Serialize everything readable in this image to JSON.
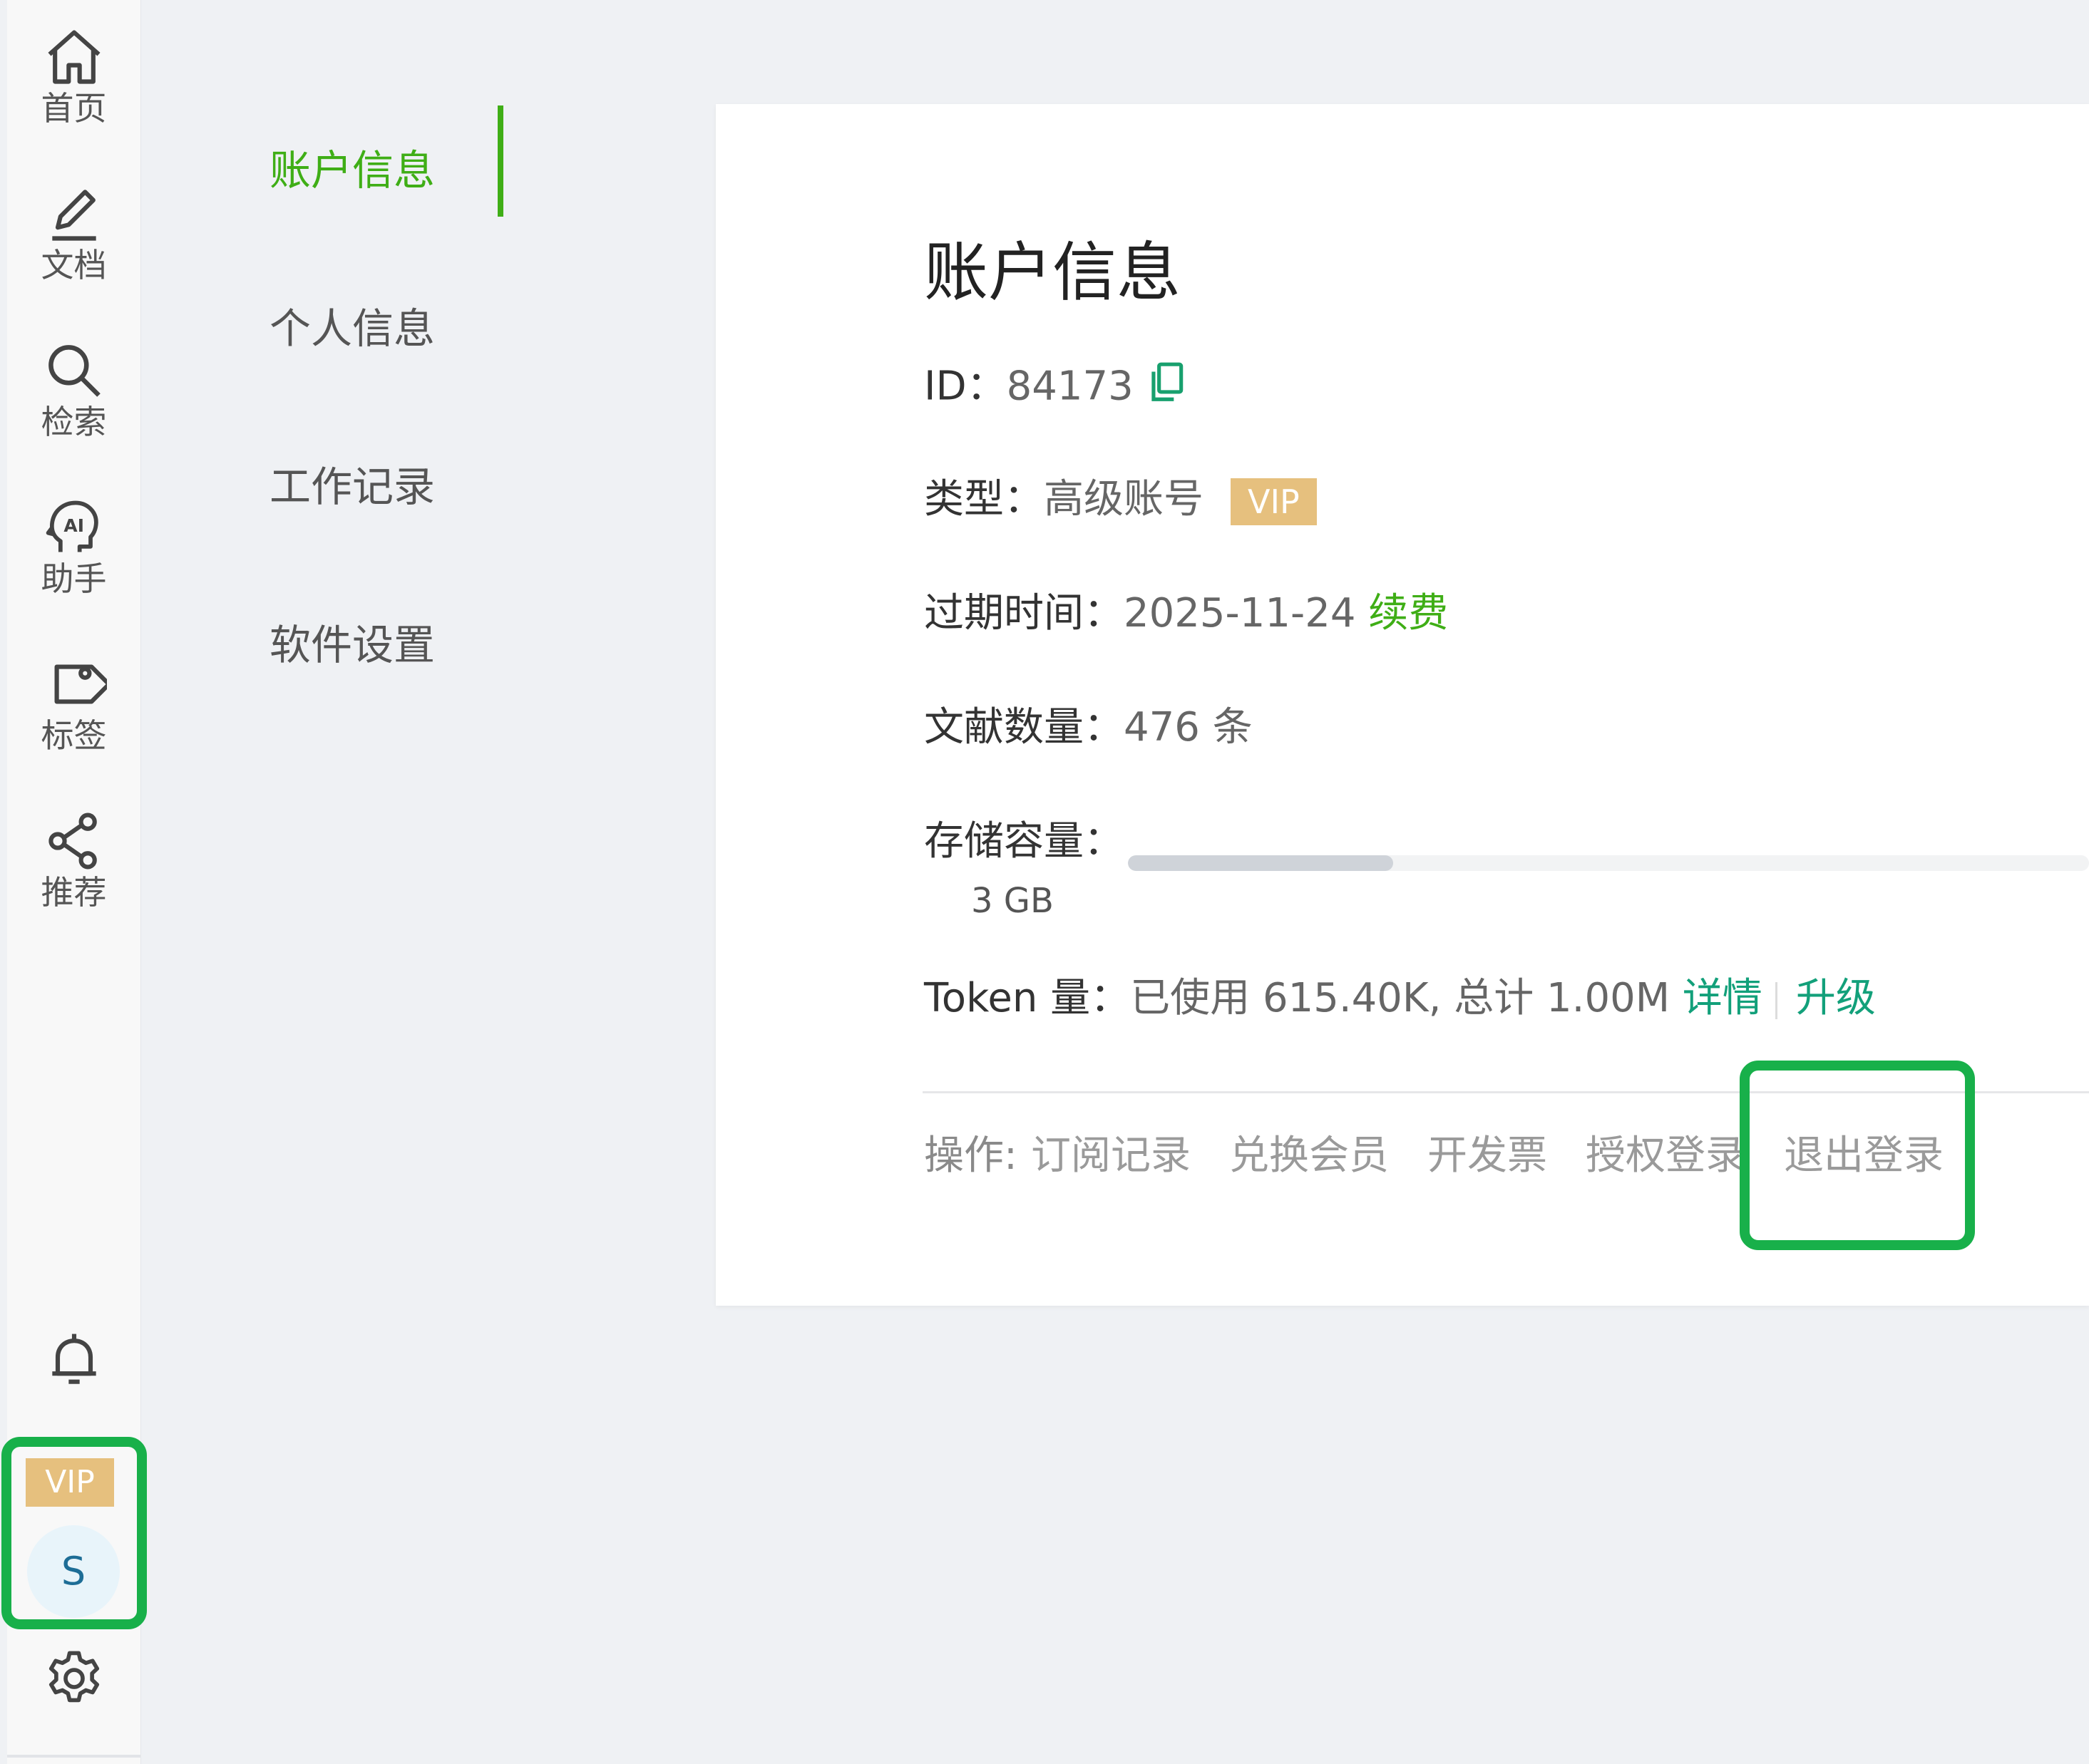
{
  "rail": {
    "items": [
      {
        "label": "首页",
        "icon": "home-icon"
      },
      {
        "label": "文档",
        "icon": "pen-icon"
      },
      {
        "label": "检索",
        "icon": "search-icon"
      },
      {
        "label": "助手",
        "icon": "ai-head-icon"
      },
      {
        "label": "标签",
        "icon": "tag-icon"
      },
      {
        "label": "推荐",
        "icon": "share-icon"
      }
    ],
    "bell_icon": "bell-icon",
    "vip_badge": "VIP",
    "avatar_initial": "S",
    "settings_icon": "gear-icon"
  },
  "submenu": {
    "items": [
      {
        "label": "账户信息",
        "active": true
      },
      {
        "label": "个人信息",
        "active": false
      },
      {
        "label": "工作记录",
        "active": false
      },
      {
        "label": "软件设置",
        "active": false
      }
    ]
  },
  "account": {
    "title": "账户信息",
    "id_label": "ID：",
    "id_value": "84173",
    "type_label": "类型：",
    "type_value": "高级账号",
    "type_tag": "VIP",
    "expire_label": "过期时间：",
    "expire_value": "2025-11-24",
    "renew_link": "续费",
    "docs_label": "文献数量：",
    "docs_value": "476 条",
    "storage_label": "存储容量：",
    "storage_total": "3 GB",
    "storage_used_fraction": 0.276,
    "token_label": "Token 量：",
    "token_value": "已使用 615.40K, 总计 1.00M",
    "token_detail_link": "详情",
    "token_upgrade_link": "升级",
    "actions_label": "操作:",
    "actions": [
      "订阅记录",
      "兑换会员",
      "开发票",
      "授权登录",
      "退出登录"
    ]
  },
  "colors": {
    "accent_green": "#3fae16",
    "teal": "#12a07a",
    "vip_gold": "#e6c07e",
    "highlight_green": "#18b04a"
  }
}
